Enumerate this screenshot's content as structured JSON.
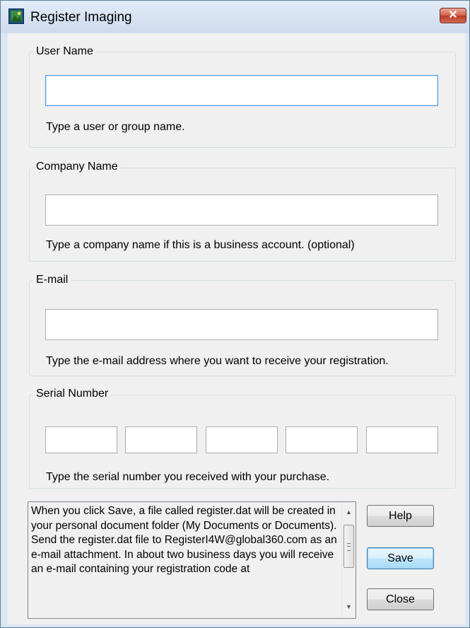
{
  "window": {
    "title": "Register Imaging",
    "close_glyph": "✕"
  },
  "user_name": {
    "label": "User Name",
    "value": "",
    "hint": "Type a user or group name."
  },
  "company_name": {
    "label": "Company Name",
    "value": "",
    "hint": "Type a company name if this is a business account. (optional)"
  },
  "email": {
    "label": "E-mail",
    "value": "",
    "hint": "Type the e-mail address where you want to receive your registration."
  },
  "serial_number": {
    "label": "Serial Number",
    "segments": [
      "",
      "",
      "",
      "",
      ""
    ],
    "hint": "Type the serial number you received with your purchase."
  },
  "info": {
    "text": "When you click Save, a file called register.dat will be created in your personal document folder (My Documents or Documents). Send the register.dat file to RegisterI4W@global360.com as an e-mail attachment. In about two business days you will receive an e-mail containing your registration code at"
  },
  "buttons": {
    "help": "Help",
    "save": "Save",
    "close": "Close"
  },
  "icons": {
    "app": "register-imaging-app-icon",
    "close": "close-icon",
    "scroll_up": "scroll-up-arrow-icon",
    "scroll_down": "scroll-down-arrow-icon"
  }
}
